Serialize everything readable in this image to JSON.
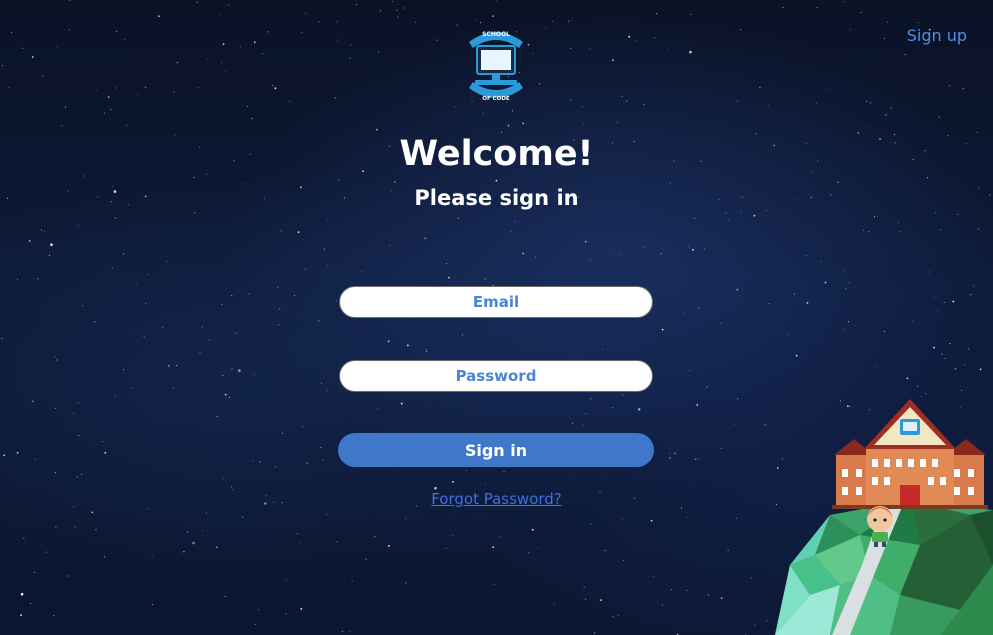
{
  "header": {
    "signup_label": "Sign up"
  },
  "logo": {
    "top_text": "SCHOOL",
    "bottom_text": "OF CODE"
  },
  "main": {
    "title": "Welcome!",
    "subtitle": "Please sign in"
  },
  "form": {
    "email_placeholder": "Email",
    "password_placeholder": "Password",
    "email_value": "",
    "password_value": "",
    "signin_label": "Sign in",
    "forgot_label": "Forgot Password?"
  },
  "colors": {
    "accent": "#3f78c9",
    "link": "#4f8fe0",
    "background": "#0b1630"
  }
}
